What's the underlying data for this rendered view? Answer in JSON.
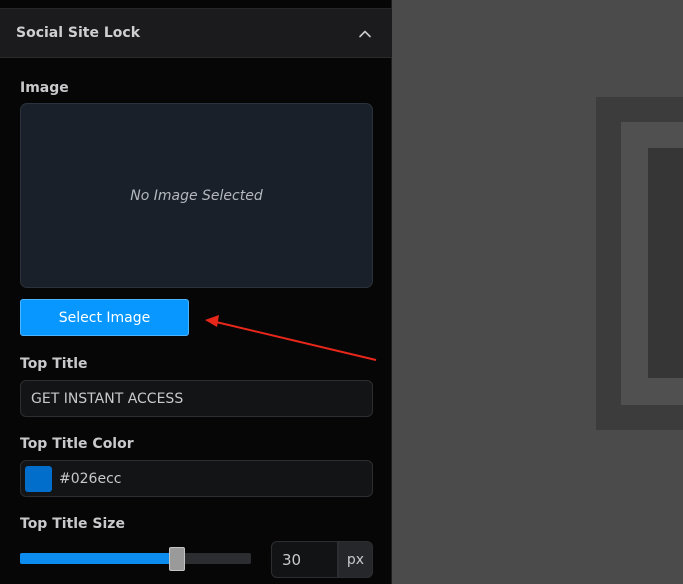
{
  "section": {
    "title": "Social Site Lock",
    "collapse_icon": "chevron-up-icon"
  },
  "image_field": {
    "label": "Image",
    "empty_text": "No Image Selected",
    "button_label": "Select Image"
  },
  "top_title": {
    "label": "Top Title",
    "value": "GET INSTANT ACCESS"
  },
  "top_title_color": {
    "label": "Top Title Color",
    "value": "#026ecc",
    "swatch_color": "#026ecc"
  },
  "top_title_size": {
    "label": "Top Title Size",
    "value": "30",
    "unit": "px",
    "slider_fraction": 0.68
  },
  "colors": {
    "accent": "#0897ff",
    "annotation_arrow": "#e8271b"
  }
}
